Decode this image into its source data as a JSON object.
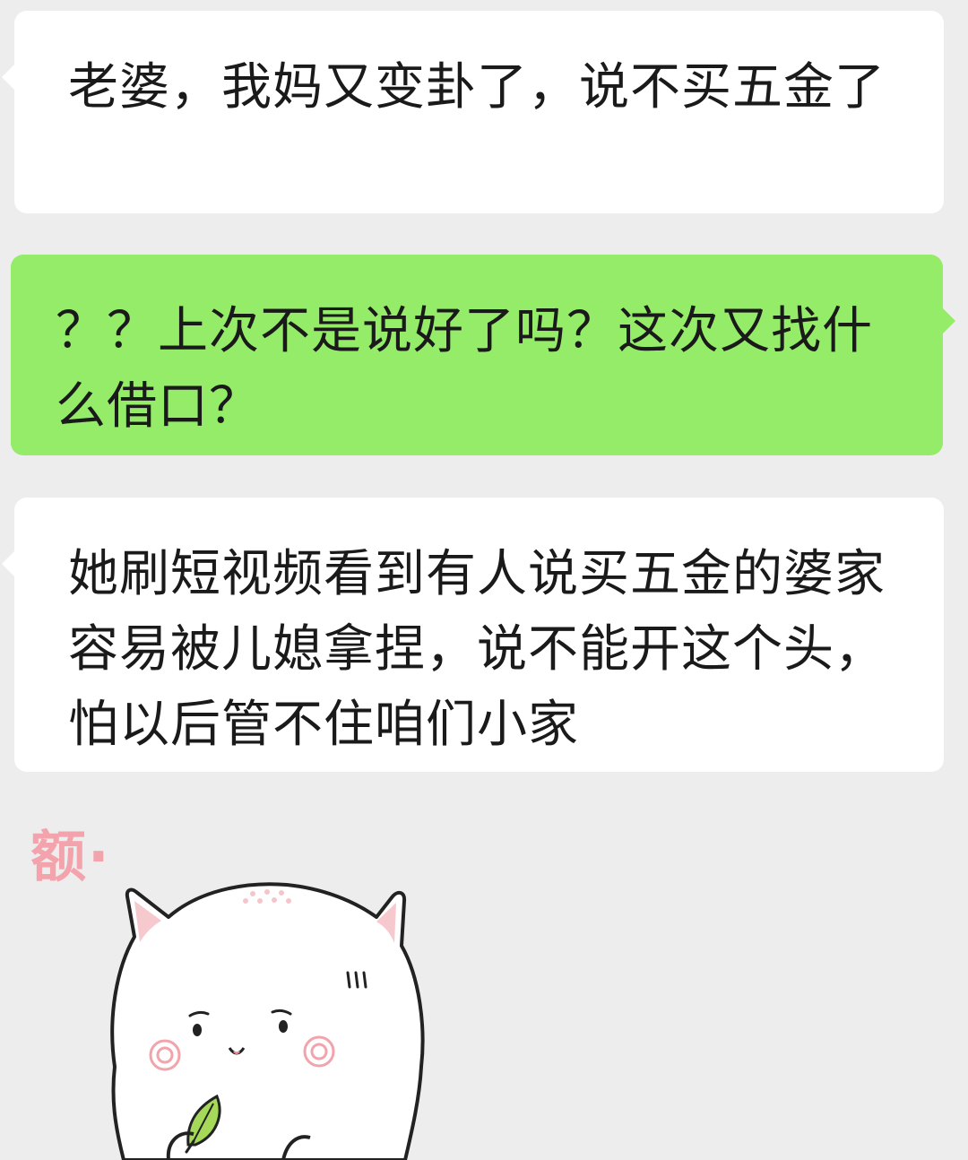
{
  "messages": [
    {
      "side": "left",
      "bubble_color": "#ffffff",
      "text": "老婆，我妈又变卦了，说不买五金了"
    },
    {
      "side": "right",
      "bubble_color": "#95ec69",
      "text": "？？上次不是说好了吗？这次又找什么借口？"
    },
    {
      "side": "left",
      "bubble_color": "#ffffff",
      "text": "她刷短视频看到有人说买五金的婆家容易被儿媳拿捏，说不能开这个头，怕以后管不住咱们小家"
    }
  ],
  "sticker": {
    "caption": "额·",
    "caption_color": "#f2a3ab",
    "icon": "white-cat-sticker-icon"
  },
  "colors": {
    "background": "#ededed",
    "incoming_bubble": "#ffffff",
    "outgoing_bubble": "#95ec69"
  }
}
